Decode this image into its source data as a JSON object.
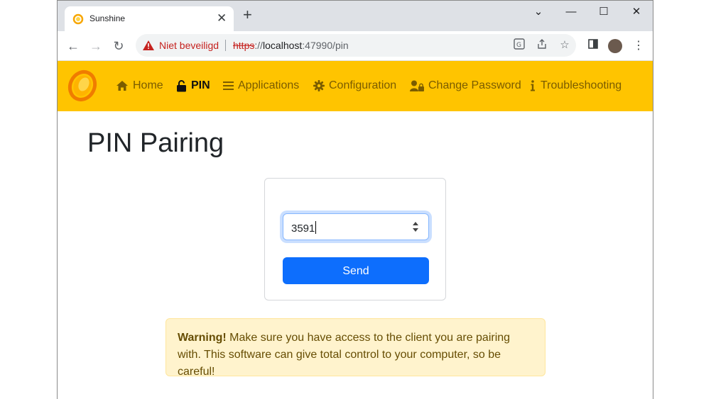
{
  "browser": {
    "tab_title": "Sunshine",
    "new_tab_label": "+",
    "security_label": "Niet beveiligd",
    "url_scheme": "https",
    "url_sep": "://",
    "url_host": "localhost",
    "url_rest": ":47990/pin"
  },
  "nav": {
    "items": [
      {
        "label": "Home",
        "icon": "home-icon"
      },
      {
        "label": "PIN",
        "icon": "unlock-icon"
      },
      {
        "label": "Applications",
        "icon": "list-icon"
      },
      {
        "label": "Configuration",
        "icon": "gear-icon"
      },
      {
        "label": "Change Password",
        "icon": "user-lock-icon"
      },
      {
        "label": "Troubleshooting",
        "icon": "info-icon"
      }
    ],
    "active": "PIN"
  },
  "page": {
    "title": "PIN Pairing",
    "pin_value": "3591",
    "send_label": "Send",
    "warning_strong": "Warning!",
    "warning_text": " Make sure you have access to the client you are pairing with. This software can give total control to your computer, so be careful!"
  },
  "colors": {
    "nav_bg": "#ffc400",
    "primary": "#0d6efd",
    "warning_bg": "#fff3cd"
  }
}
